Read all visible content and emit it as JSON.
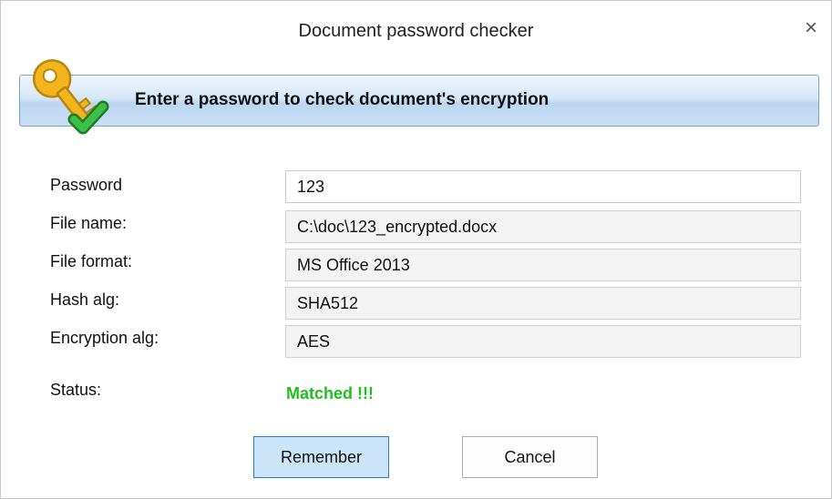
{
  "window": {
    "title": "Document password checker",
    "close_glyph": "×"
  },
  "banner": {
    "text": "Enter a password to check document's encryption",
    "icon": "key-check-icon"
  },
  "form": {
    "password": {
      "label": "Password",
      "value": "123"
    },
    "file_name": {
      "label": "File name:",
      "value": "C:\\doc\\123_encrypted.docx"
    },
    "file_format": {
      "label": "File format:",
      "value": "MS Office 2013"
    },
    "hash_alg": {
      "label": "Hash alg:",
      "value": "SHA512"
    },
    "encryption_alg": {
      "label": "Encryption alg:",
      "value": "AES"
    },
    "status": {
      "label": "Status:",
      "value": "Matched !!!",
      "color": "#1fbf1f"
    }
  },
  "buttons": {
    "remember": "Remember",
    "cancel": "Cancel"
  },
  "colors": {
    "banner_border": "#7aa3cc",
    "key": "#f2b51d",
    "check": "#2ea83a",
    "primary_button_fill": "#cce4f7",
    "primary_button_border": "#2a7ad2"
  }
}
